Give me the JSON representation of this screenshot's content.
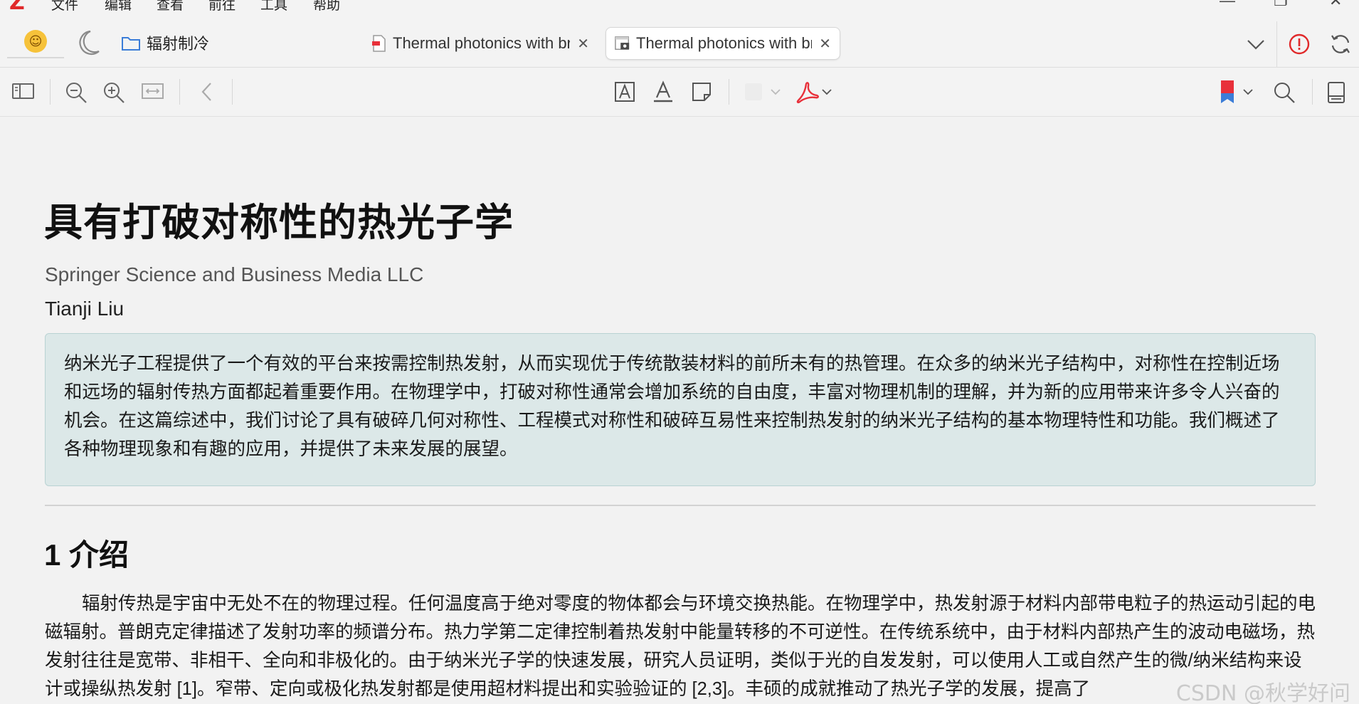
{
  "app": {
    "logo_letter": "Z",
    "menu": [
      "文件",
      "编辑",
      "查看",
      "前往",
      "工具",
      "帮助"
    ],
    "window_controls": [
      "—",
      "❐",
      "✕"
    ]
  },
  "tabbar": {
    "emoji": "☺",
    "collection_label": "辐射制冷",
    "tabs": [
      {
        "title": "Thermal photonics with broken symmetries",
        "close": "✕",
        "active": false
      },
      {
        "title": "Thermal photonics with broken symmetries",
        "close": "✕",
        "active": true
      }
    ]
  },
  "toolbar": {
    "colors": {
      "annotation_red": "#e8303a",
      "bookmark_red": "#e8303a",
      "bookmark_blue": "#3b7dd8"
    }
  },
  "document": {
    "title": "具有打破对称性的热光子学",
    "publisher": "Springer Science and Business Media LLC",
    "author": "Tianji Liu",
    "abstract": "纳米光子工程提供了一个有效的平台来按需控制热发射，从而实现优于传统散装材料的前所未有的热管理。在众多的纳米光子结构中，对称性在控制近场和远场的辐射传热方面都起着重要作用。在物理学中，打破对称性通常会增加系统的自由度，丰富对物理机制的理解，并为新的应用带来许多令人兴奋的机会。在这篇综述中，我们讨论了具有破碎几何对称性、工程模式对称性和破碎互易性来控制热发射的纳米光子结构的基本物理特性和功能。我们概述了各种物理现象和有趣的应用，并提供了未来发展的展望。",
    "section1_heading": "1 介绍",
    "section1_paragraph": "辐射传热是宇宙中无处不在的物理过程。任何温度高于绝对零度的物体都会与环境交换热能。在物理学中，热发射源于材料内部带电粒子的热运动引起的电磁辐射。普朗克定律描述了发射功率的频谱分布。热力学第二定律控制着热发射中能量转移的不可逆性。在传统系统中，由于材料内部热产生的波动电磁场，热发射往往是宽带、非相干、全向和非极化的。由于纳米光子学的快速发展，研究人员证明，类似于光的自发发射，可以使用人工或自然产生的微/纳米结构来设计或操纵热发射 [1]。窄带、定向或极化热发射都是使用超材料提出和实验验证的 [2,3]。丰硕的成就推动了热光子学的发展，提高了"
  },
  "watermark": "CSDN @秋学好问"
}
